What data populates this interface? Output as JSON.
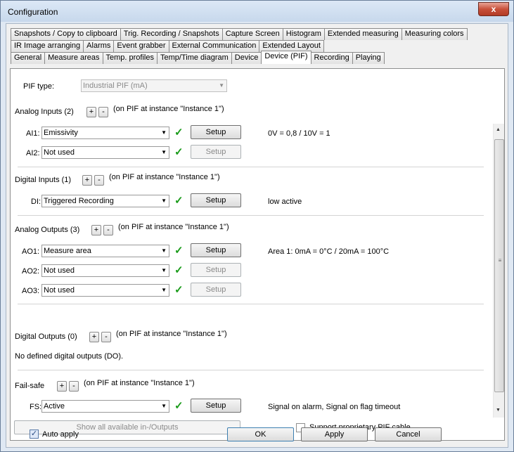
{
  "window": {
    "title": "Configuration",
    "close_label": "x"
  },
  "tabs_row1": [
    "Snapshots / Copy to clipboard",
    "Trig. Recording / Snapshots",
    "Capture Screen",
    "Histogram",
    "Extended measuring",
    "Measuring colors"
  ],
  "tabs_row2": [
    "IR Image arranging",
    "Alarms",
    "Event grabber",
    "External Communication",
    "Extended Layout"
  ],
  "tabs_row3": [
    "General",
    "Measure areas",
    "Temp. profiles",
    "Temp/Time diagram",
    "Device",
    "Device (PIF)",
    "Recording",
    "Playing"
  ],
  "active_tab": "Device (PIF)",
  "pif_type": {
    "label": "PIF type:",
    "value": "Industrial PIF (mA)"
  },
  "plus": "+",
  "minus": "-",
  "check": "✓",
  "arrow": "▼",
  "setup": "Setup",
  "analog_inputs": {
    "title": "Analog Inputs (2)",
    "instance": "(on PIF at instance \"Instance 1\")",
    "rows": [
      {
        "label": "AI1:",
        "value": "Emissivity",
        "setup_enabled": true,
        "info": "0V = 0,8 / 10V = 1"
      },
      {
        "label": "AI2:",
        "value": "Not used",
        "setup_enabled": false,
        "info": ""
      }
    ]
  },
  "digital_inputs": {
    "title": "Digital Inputs (1)",
    "instance": "(on PIF at instance \"Instance 1\")",
    "rows": [
      {
        "label": "DI:",
        "value": "Triggered Recording",
        "setup_enabled": true,
        "info": "low active"
      }
    ]
  },
  "analog_outputs": {
    "title": "Analog Outputs (3)",
    "instance": "(on PIF at instance \"Instance 1\")",
    "rows": [
      {
        "label": "AO1:",
        "value": "Measure area",
        "setup_enabled": true,
        "info": "Area 1: 0mA = 0°C / 20mA = 100°C"
      },
      {
        "label": "AO2:",
        "value": "Not used",
        "setup_enabled": false,
        "info": ""
      },
      {
        "label": "AO3:",
        "value": "Not used",
        "setup_enabled": false,
        "info": ""
      }
    ]
  },
  "digital_outputs": {
    "title": "Digital Outputs (0)",
    "instance": "(on PIF at instance \"Instance 1\")",
    "empty_text": "No defined digital outputs (DO)."
  },
  "fail_safe": {
    "title": "Fail-safe",
    "instance": "(on PIF at instance \"Instance 1\")",
    "rows": [
      {
        "label": "FS:",
        "value": "Active",
        "setup_enabled": true,
        "info": "Signal on alarm, Signal on flag timeout"
      }
    ]
  },
  "show_all_button": "Show all available in-/Outputs",
  "support_cable": {
    "label": "Support proprietary PIF cable",
    "checked": false
  },
  "auto_apply": {
    "label": "Auto apply",
    "checked": true,
    "mark": "✓"
  },
  "ok_button": "OK",
  "apply_button": "Apply",
  "cancel_button": "Cancel",
  "scrollbar": {
    "up": "▲",
    "down": "▼",
    "grip": "≡"
  }
}
